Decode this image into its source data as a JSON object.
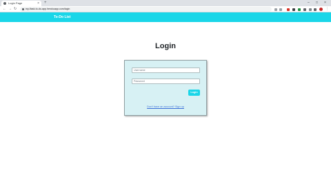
{
  "browser": {
    "tab_title": "Login Page",
    "tab_close": "×",
    "new_tab": "+",
    "url": "my-flask-to-do-app.herokuapp.com/login",
    "window_controls": [
      "–",
      "□",
      "×"
    ],
    "nav": {
      "back": "←",
      "forward": "→",
      "reload": "↻"
    },
    "menu": "⋮"
  },
  "navbar": {
    "brand": "To-Do List"
  },
  "page": {
    "title": "Login"
  },
  "login_form": {
    "username_placeholder": "Username",
    "password_placeholder": "Password",
    "submit_label": "Login",
    "signup_text": "Don't have an account? Sign up"
  },
  "colors": {
    "accent": "#1ad6e8",
    "card_bg": "#d7f1f4",
    "link": "#3b6fd8"
  }
}
